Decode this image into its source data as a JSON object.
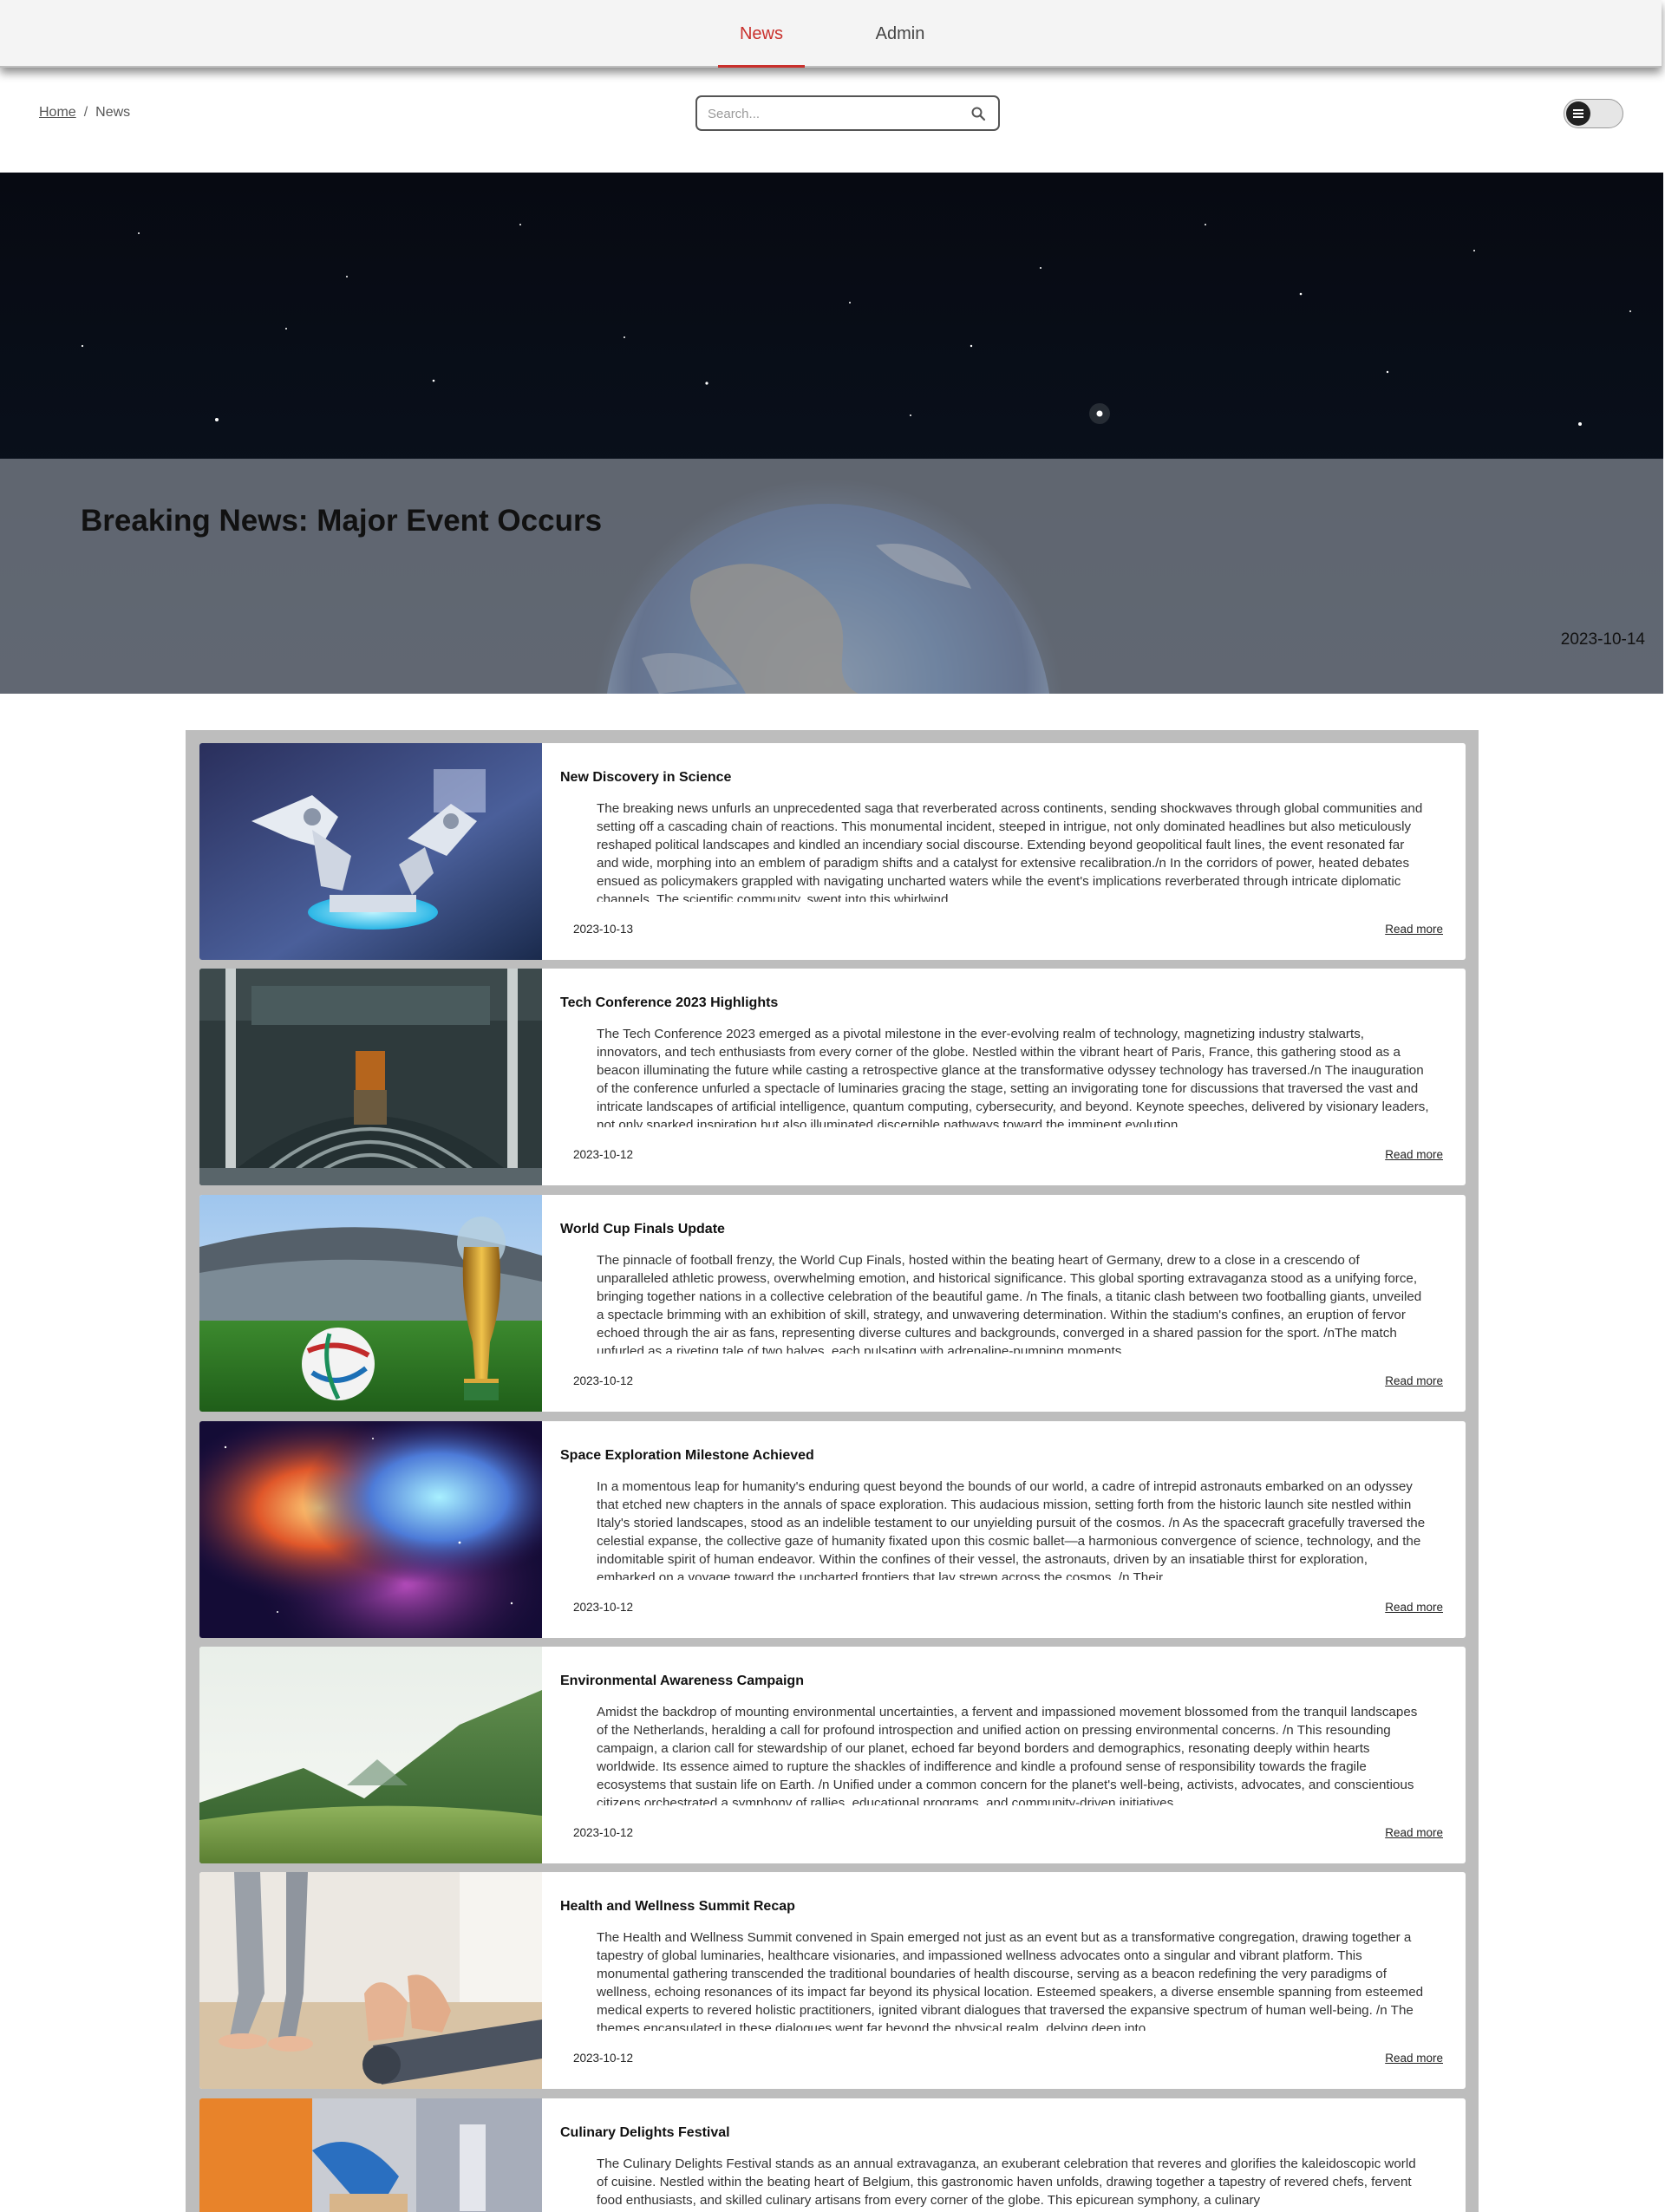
{
  "nav": {
    "tabs": [
      {
        "label": "News",
        "active": true
      },
      {
        "label": "Admin",
        "active": false
      }
    ]
  },
  "breadcrumb": {
    "home": "Home",
    "separator": "/",
    "current": "News"
  },
  "search": {
    "placeholder": "Search...",
    "icon": "magnifier"
  },
  "theme_toggle": {
    "icon": "menu-lines"
  },
  "hero": {
    "title": "Breaking News: Major Event Occurs",
    "date": "2023-10-14"
  },
  "articles": [
    {
      "title": "New Discovery in Science",
      "date": "2023-10-13",
      "more": "Read more",
      "image": "robot-arms-lab",
      "excerpt": "The breaking news unfurls an unprecedented saga that reverberated across continents, sending shockwaves through global communities and setting off a cascading chain of reactions. This monumental incident, steeped in intrigue, not only dominated headlines but also meticulously reshaped political landscapes and kindled an incendiary social discourse. Extending beyond geopolitical fault lines, the event resonated far and wide, morphing into an emblem of paradigm shifts and a catalyst for extensive recalibration./n In the corridors of power, heated debates ensued as policymakers grappled with navigating uncharted waters while the event's implications reverberated through intricate diplomatic channels. The scientific community, swept into this whirlwind,"
    },
    {
      "title": "Tech Conference 2023 Highlights",
      "date": "2023-10-12",
      "more": "Read more",
      "image": "parliament-chamber",
      "excerpt": "The Tech Conference 2023 emerged as a pivotal milestone in the ever-evolving realm of technology, magnetizing industry stalwarts, innovators, and tech enthusiasts from every corner of the globe. Nestled within the vibrant heart of Paris, France, this gathering stood as a beacon illuminating the future while casting a retrospective glance at the transformative odyssey technology has traversed./n The inauguration of the conference unfurled a spectacle of luminaries gracing the stage, setting an invigorating tone for discussions that traversed the vast and intricate landscapes of artificial intelligence, quantum computing, cybersecurity, and beyond. Keynote speeches, delivered by visionary leaders, not only sparked inspiration but also illuminated discernible pathways toward the imminent evolution"
    },
    {
      "title": "World Cup Finals Update",
      "date": "2023-10-12",
      "more": "Read more",
      "image": "stadium-trophy-ball",
      "excerpt": "The pinnacle of football frenzy, the World Cup Finals, hosted within the beating heart of Germany, drew to a close in a crescendo of unparalleled athletic prowess, overwhelming emotion, and historical significance. This global sporting extravaganza stood as a unifying force, bringing together nations in a collective celebration of the beautiful game. /n The finals, a titanic clash between two footballing giants, unveiled a spectacle brimming with an exhibition of skill, strategy, and unwavering determination. Within the stadium's confines, an eruption of fervor echoed through the air as fans, representing diverse cultures and backgrounds, converged in a shared passion for the sport. /nThe match unfurled as a riveting tale of two halves, each pulsating with adrenaline-pumping moments,"
    },
    {
      "title": "Space Exploration Milestone Achieved",
      "date": "2023-10-12",
      "more": "Read more",
      "image": "nebula",
      "excerpt": "In a momentous leap for humanity's enduring quest beyond the bounds of our world, a cadre of intrepid astronauts embarked on an odyssey that etched new chapters in the annals of space exploration. This audacious mission, setting forth from the historic launch site nestled within Italy's storied landscapes, stood as an indelible testament to our unyielding pursuit of the cosmos. /n As the spacecraft gracefully traversed the celestial expanse, the collective gaze of humanity fixated upon this cosmic ballet—a harmonious convergence of science, technology, and the indomitable spirit of human endeavor. Within the confines of their vessel, the astronauts, driven by an insatiable thirst for exploration, embarked on a voyage toward the uncharted frontiers that lay strewn across the cosmos. /n Their"
    },
    {
      "title": "Environmental Awareness Campaign",
      "date": "2023-10-12",
      "more": "Read more",
      "image": "green-hills",
      "excerpt": "Amidst the backdrop of mounting environmental uncertainties, a fervent and impassioned movement blossomed from the tranquil landscapes of the Netherlands, heralding a call for profound introspection and unified action on pressing environmental concerns. /n This resounding campaign, a clarion call for stewardship of our planet, echoed far beyond borders and demographics, resonating deeply within hearts worldwide. Its essence aimed to rupture the shackles of indifference and kindle a profound sense of responsibility towards the fragile ecosystems that sustain life on Earth. /n Unified under a common concern for the planet's well-being, activists, advocates, and conscientious citizens orchestrated a symphony of rallies, educational programs, and community-driven initiatives."
    },
    {
      "title": "Health and Wellness Summit Recap",
      "date": "2023-10-12",
      "more": "Read more",
      "image": "yoga-mat",
      "excerpt": "The Health and Wellness Summit convened in Spain emerged not just as an event but as a transformative congregation, drawing together a tapestry of global luminaries, healthcare visionaries, and impassioned wellness advocates onto a singular and vibrant platform. This monumental gathering transcended the traditional boundaries of health discourse, serving as a beacon redefining the very paradigms of wellness, echoing resonances of its impact far beyond its physical location. Esteemed speakers, a diverse ensemble spanning from esteemed medical experts to revered holistic practitioners, ignited vibrant dialogues that traversed the expansive spectrum of human well-being. /n The themes encapsulated in these dialogues went far beyond the physical realm, delving deep into"
    },
    {
      "title": "Culinary Delights Festival",
      "date": "",
      "more": "",
      "image": "chef-kitchen",
      "excerpt": "The Culinary Delights Festival stands as an annual extravaganza, an exuberant celebration that reveres and glorifies the kaleidoscopic world of cuisine. Nestled within the beating heart of Belgium, this gastronomic haven unfolds, drawing together a tapestry of revered chefs, fervent food enthusiasts, and skilled culinary artisans from every corner of the globe. This epicurean symphony, a culinary"
    }
  ]
}
